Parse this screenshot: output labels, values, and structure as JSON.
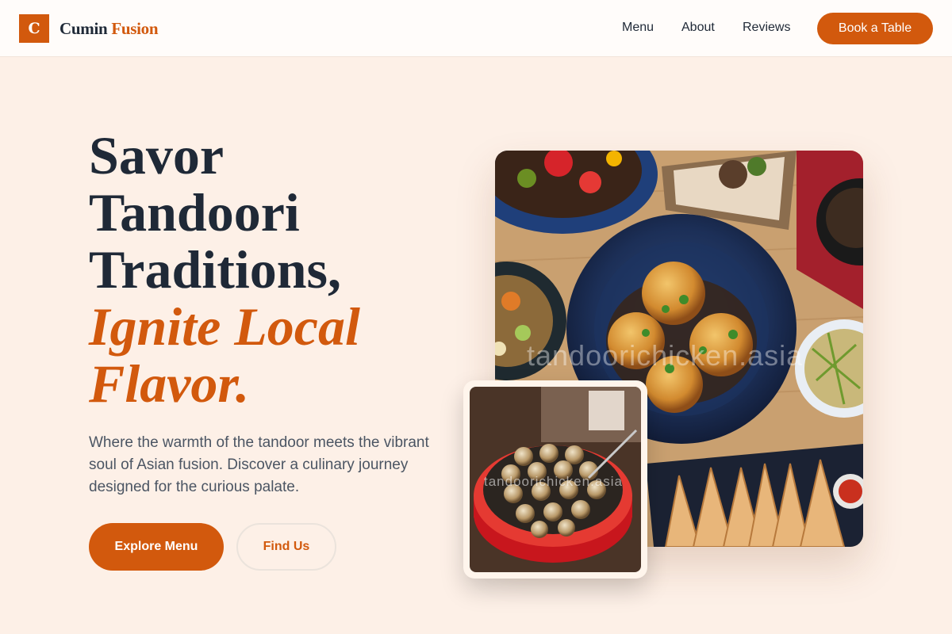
{
  "header": {
    "logo_letter": "C",
    "brand_first": "Cumin",
    "brand_second": "Fusion",
    "nav": [
      "Menu",
      "About",
      "Reviews"
    ],
    "cta": "Book a Table"
  },
  "hero": {
    "headline_lines": [
      "Savor",
      "Tandoori",
      "Traditions,"
    ],
    "headline_accent_lines": [
      "Ignite Local",
      "Flavor."
    ],
    "lede": "Where the warmth of the tandoor meets the vibrant soul of Asian fusion. Discover a culinary journey designed for the curious palate.",
    "primary_button": "Explore Menu",
    "secondary_button": "Find Us"
  },
  "images": {
    "main_alt": "Overhead spread of stuffed mushrooms on a blue plate, dumplings, salads and stir-fries",
    "main_watermark": "tandoorichicken.asia",
    "small_alt": "Takoyaki balls cooking in a red electric pan",
    "small_watermark": "tandoorichicken.asia"
  },
  "colors": {
    "accent": "#d2590d",
    "page_bg": "#fdf0e7",
    "ink": "#1f2937"
  }
}
